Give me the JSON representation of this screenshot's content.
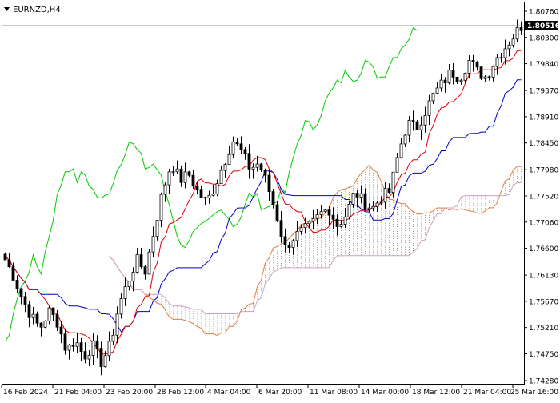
{
  "header": {
    "symbol_label": "EURNZD,H4"
  },
  "price_scale": {
    "labels": [
      "1.80760",
      "1.80300",
      "1.79840",
      "1.79370",
      "1.78910",
      "1.78450",
      "1.77980",
      "1.77520",
      "1.77060",
      "1.76600",
      "1.76130",
      "1.75670",
      "1.75210",
      "1.74750",
      "1.74280"
    ],
    "current_price": "1.80516"
  },
  "time_axis": {
    "labels": [
      "16 Feb 2024",
      "21 Feb 04:00",
      "23 Feb 20:00",
      "28 Feb 12:00",
      "4 Mar 04:00",
      "6 Mar 20:00",
      "11 Mar 08:00",
      "14 Mar 00:00",
      "18 Mar 12:00",
      "21 Mar 04:00",
      "25 Mar 16:00"
    ]
  },
  "colors": {
    "tenkan": "#dd0000",
    "kijun": "#0000cc",
    "chikou": "#00cc00",
    "cloud_bull": "#e08040",
    "cloud_bear": "#d0a0c0",
    "candle": "#000000",
    "price_line": "#8899aa"
  },
  "chart_data": {
    "type": "candlestick",
    "symbol": "EURNZD",
    "timeframe": "H4",
    "y_range": [
      1.7428,
      1.8076
    ],
    "current_price": 1.80516,
    "indicators": [
      "Ichimoku Kinko Hyo"
    ],
    "close_path": [
      1.764,
      1.761,
      1.757,
      1.754,
      1.752,
      1.755,
      1.753,
      1.748,
      1.75,
      1.747,
      1.749,
      1.746,
      1.749,
      1.756,
      1.76,
      1.764,
      1.762,
      1.769,
      1.776,
      1.781,
      1.778,
      1.779,
      1.776,
      1.774,
      1.777,
      1.781,
      1.785,
      1.783,
      1.78,
      1.781,
      1.777,
      1.772,
      1.766,
      1.768,
      1.769,
      1.77,
      1.772,
      1.773,
      1.77,
      1.772,
      1.776,
      1.774,
      1.773,
      1.775,
      1.776,
      1.783,
      1.788,
      1.787,
      1.79,
      1.793,
      1.795,
      1.797,
      1.796,
      1.799,
      1.797,
      1.796,
      1.799,
      1.801,
      1.803,
      1.805
    ]
  }
}
